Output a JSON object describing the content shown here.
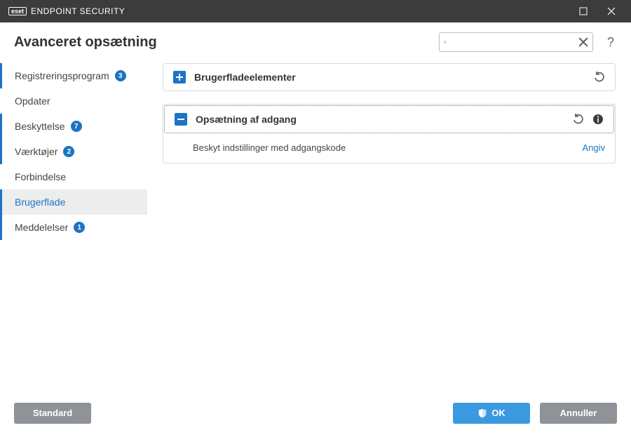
{
  "window": {
    "brand_box": "eset",
    "brand_text": "ENDPOINT SECURITY"
  },
  "header": {
    "title": "Avanceret opsætning",
    "search_placeholder": "",
    "help": "?"
  },
  "sidebar": {
    "items": [
      {
        "label": "Registreringsprogram",
        "badge": "3",
        "marked": true,
        "active": false
      },
      {
        "label": "Opdater",
        "badge": "",
        "marked": false,
        "active": false
      },
      {
        "label": "Beskyttelse",
        "badge": "7",
        "marked": true,
        "active": false
      },
      {
        "label": "Værktøjer",
        "badge": "2",
        "marked": true,
        "active": false
      },
      {
        "label": "Forbindelse",
        "badge": "",
        "marked": false,
        "active": false
      },
      {
        "label": "Brugerflade",
        "badge": "",
        "marked": true,
        "active": true
      },
      {
        "label": "Meddelelser",
        "badge": "1",
        "marked": true,
        "active": false
      }
    ]
  },
  "panels": {
    "ui_elements": {
      "title": "Brugerfladeelementer"
    },
    "access_setup": {
      "title": "Opsætning af adgang",
      "row_label": "Beskyt indstillinger med adgangskode",
      "row_action": "Angiv"
    }
  },
  "footer": {
    "default": "Standard",
    "ok": "OK",
    "cancel": "Annuller"
  }
}
